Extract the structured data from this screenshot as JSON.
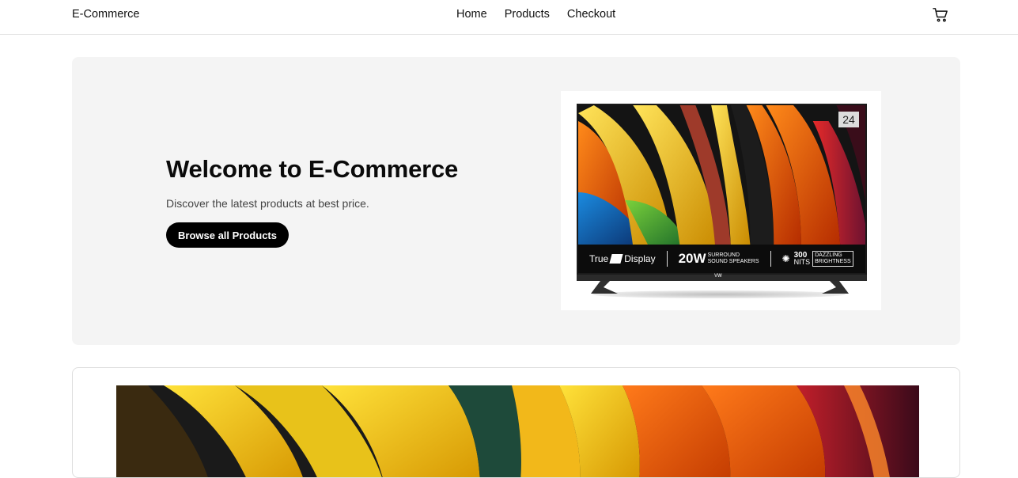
{
  "navbar": {
    "brand": "E-Commerce",
    "links": [
      "Home",
      "Products",
      "Checkout"
    ],
    "cart_icon": "cart-icon"
  },
  "hero": {
    "title": "Welcome to E-Commerce",
    "subtitle": "Discover the latest products at best price.",
    "button_label": "Browse all Products",
    "image": {
      "badge": "24",
      "features": {
        "display_prefix": "True",
        "display_suffix": "Display",
        "power": "20W",
        "power_detail_1": "SURROUND",
        "power_detail_2": "SOUND SPEAKERS",
        "nits": "300",
        "nits_unit": "NITS",
        "nits_detail_1": "DAZZLING",
        "nits_detail_2": "BRIGHTNESS"
      },
      "logo": "VW"
    }
  },
  "colors": {
    "hero_bg": "#f4f4f4",
    "button_bg": "#000000",
    "button_text": "#ffffff"
  }
}
